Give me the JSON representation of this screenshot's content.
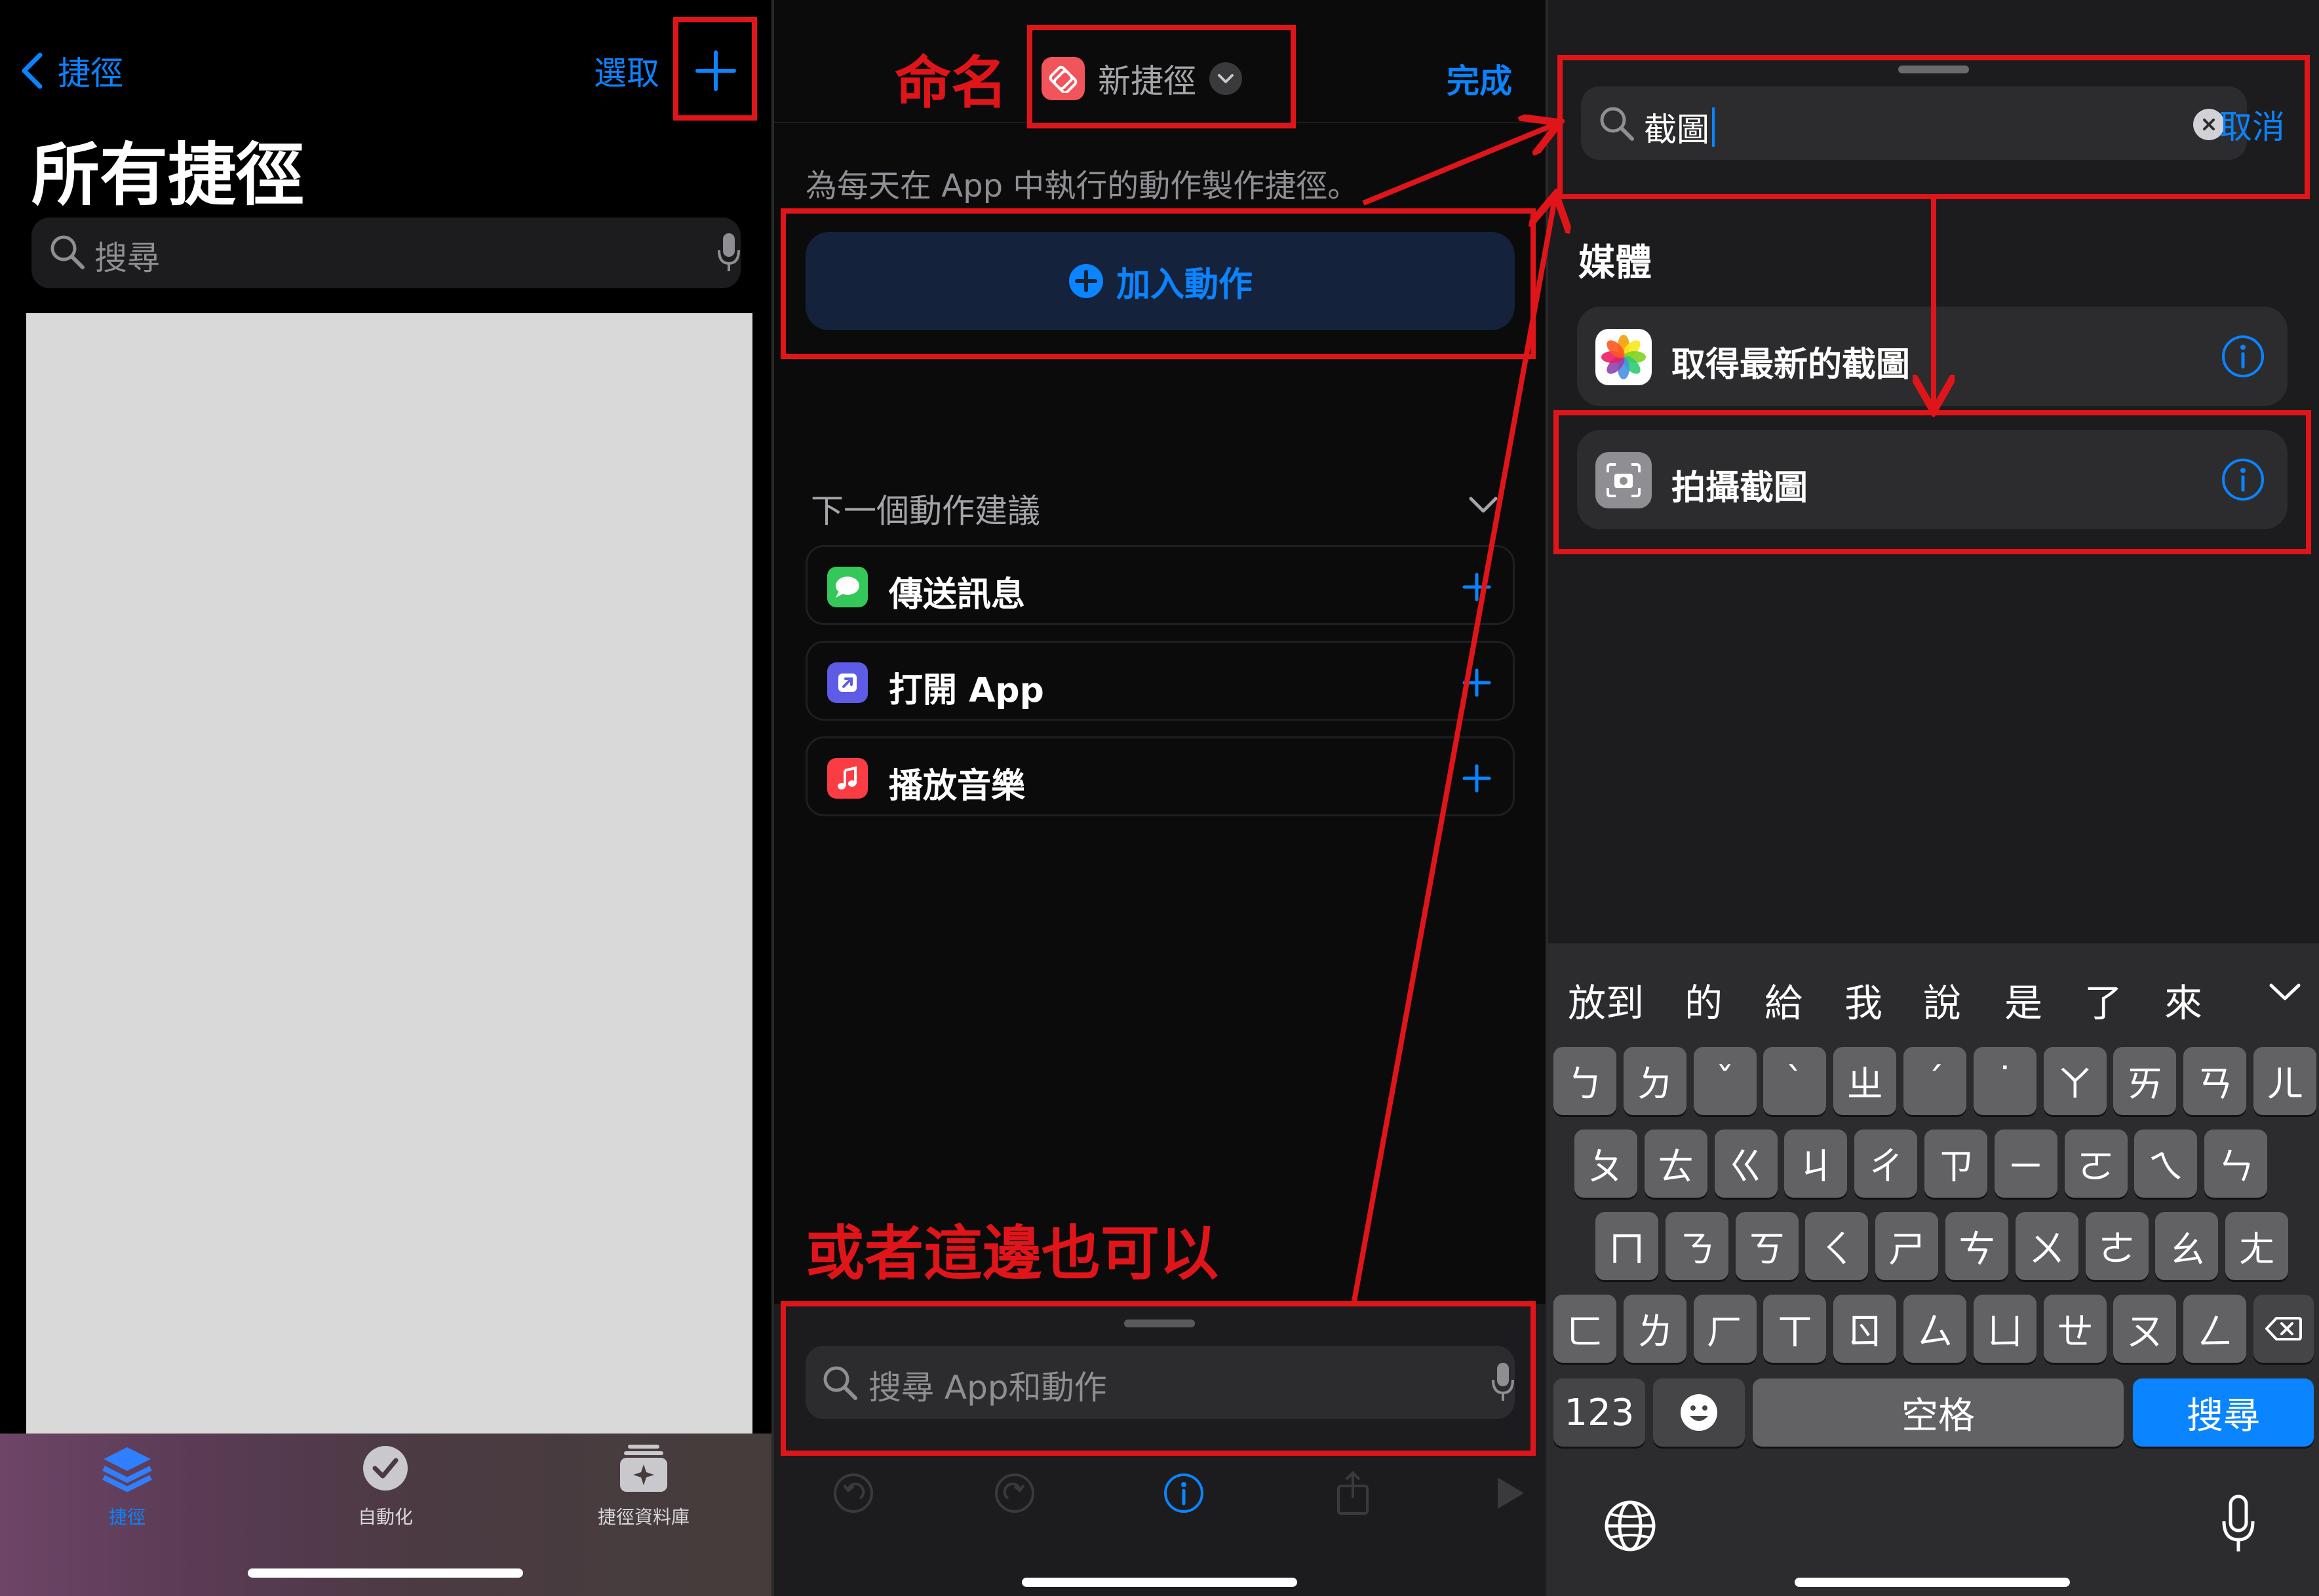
{
  "panel1": {
    "back_label": "捷徑",
    "select_label": "選取",
    "title": "所有捷徑",
    "search_placeholder": "搜尋",
    "tabs": [
      {
        "label": "捷徑",
        "icon": "layers-icon",
        "active": true
      },
      {
        "label": "自動化",
        "icon": "clock-check-icon",
        "active": false
      },
      {
        "label": "捷徑資料庫",
        "icon": "gallery-icon",
        "active": false
      }
    ]
  },
  "panel2": {
    "annotation_name": "命名",
    "shortcut_name": "新捷徑",
    "done_label": "完成",
    "description": "為每天在 App 中執行的動作製作捷徑。",
    "add_action_label": "加入動作",
    "suggestions_header": "下一個動作建議",
    "suggestions": [
      {
        "label": "傳送訊息",
        "icon": "messages-icon",
        "color": "#34c759"
      },
      {
        "label": "打開 App",
        "icon": "open-app-icon",
        "color": "#5e5ce6"
      },
      {
        "label": "播放音樂",
        "icon": "music-icon",
        "color": "#fc3c44"
      }
    ],
    "annotation_or": "或者這邊也可以",
    "search_placeholder": "搜尋 App和動作"
  },
  "panel3": {
    "search_value": "截圖",
    "cancel_label": "取消",
    "section_title": "媒體",
    "results": [
      {
        "label": "取得最新的截圖",
        "icon": "photos-icon"
      },
      {
        "label": "拍攝截圖",
        "icon": "screenshot-icon"
      }
    ],
    "candidates": [
      "放到",
      "的",
      "給",
      "我",
      "說",
      "是",
      "了",
      "來"
    ],
    "keyboard": {
      "row1": [
        "ㄅ",
        "ㄉ",
        "ˇ",
        "ˋ",
        "ㄓ",
        "ˊ",
        "˙",
        "ㄚ",
        "ㄞ",
        "ㄢ",
        "ㄦ"
      ],
      "row2": [
        "ㄆ",
        "ㄊ",
        "ㄍ",
        "ㄐ",
        "ㄔ",
        "ㄗ",
        "ㄧ",
        "ㄛ",
        "ㄟ",
        "ㄣ"
      ],
      "row3": [
        "ㄇ",
        "ㄋ",
        "ㄎ",
        "ㄑ",
        "ㄕ",
        "ㄘ",
        "ㄨ",
        "ㄜ",
        "ㄠ",
        "ㄤ"
      ],
      "row4": [
        "ㄈ",
        "ㄌ",
        "ㄏ",
        "ㄒ",
        "ㄖ",
        "ㄙ",
        "ㄩ",
        "ㄝ",
        "ㄡ",
        "ㄥ"
      ],
      "numbers_label": "123",
      "space_label": "空格",
      "search_label": "搜尋"
    }
  },
  "colors": {
    "accent": "#0a84ff",
    "annotation": "#e0151a",
    "placeholder_card": "#d9d9d9"
  }
}
